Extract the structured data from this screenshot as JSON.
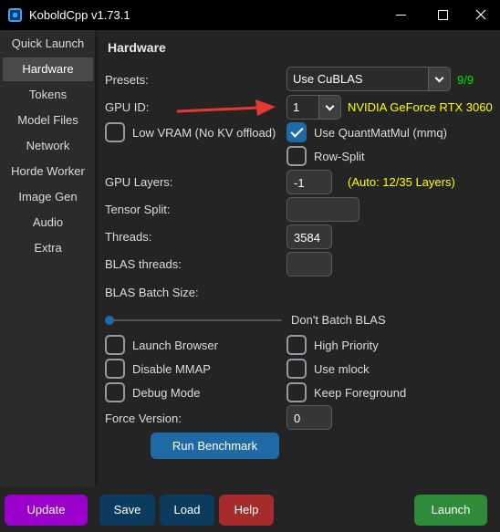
{
  "window": {
    "title": "KoboldCpp v1.73.1"
  },
  "sidebar": {
    "items": [
      {
        "label": "Quick Launch",
        "active": false
      },
      {
        "label": "Hardware",
        "active": true
      },
      {
        "label": "Tokens",
        "active": false
      },
      {
        "label": "Model Files",
        "active": false
      },
      {
        "label": "Network",
        "active": false
      },
      {
        "label": "Horde Worker",
        "active": false
      },
      {
        "label": "Image Gen",
        "active": false
      },
      {
        "label": "Audio",
        "active": false
      },
      {
        "label": "Extra",
        "active": false
      }
    ]
  },
  "hardware": {
    "heading": "Hardware",
    "presets_label": "Presets:",
    "presets_value": "Use CuBLAS",
    "presets_count": "9/9",
    "gpu_id_label": "GPU ID:",
    "gpu_id_value": "1",
    "gpu_name": "NVIDIA GeForce RTX 3060",
    "low_vram_label": "Low VRAM (No KV offload)",
    "low_vram_checked": false,
    "quantmatmul_label": "Use QuantMatMul (mmq)",
    "quantmatmul_checked": true,
    "rowsplit_label": "Row-Split",
    "rowsplit_checked": false,
    "gpu_layers_label": "GPU Layers:",
    "gpu_layers_value": "-1",
    "gpu_layers_auto": "(Auto: 12/35 Layers)",
    "tensor_split_label": "Tensor Split:",
    "tensor_split_value": "",
    "threads_label": "Threads:",
    "threads_value": "3584",
    "blas_threads_label": "BLAS threads:",
    "blas_threads_value": "",
    "blas_batch_label": "BLAS Batch Size:",
    "blas_batch_value_text": "Don't Batch BLAS",
    "blas_batch_slider_position": 0,
    "launch_browser_label": "Launch Browser",
    "high_priority_label": "High Priority",
    "disable_mmap_label": "Disable MMAP",
    "use_mlock_label": "Use mlock",
    "debug_mode_label": "Debug Mode",
    "keep_foreground_label": "Keep Foreground",
    "force_version_label": "Force Version:",
    "force_version_value": "0",
    "benchmark_label": "Run Benchmark"
  },
  "footer": {
    "update_label": "Update",
    "save_label": "Save",
    "load_label": "Load",
    "help_label": "Help",
    "launch_label": "Launch"
  },
  "colors": {
    "accent": "#1f6aa5",
    "update": "#9900cc",
    "help": "#a62c2b",
    "launch": "#2e8b3a",
    "gpu_name": "#ffff00",
    "preset_count": "#00e500",
    "annotation_arrow": "#e53935"
  },
  "icons": [
    "app-icon",
    "minimize-icon",
    "maximize-icon",
    "close-icon",
    "chevron-down-icon",
    "checkmark-icon",
    "annotation-arrow-icon"
  ]
}
